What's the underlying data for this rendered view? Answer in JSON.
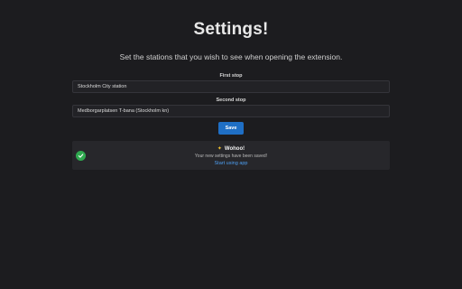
{
  "header": {
    "title": "Settings!",
    "subtitle": "Set the stations that you wish to see when opening the extension."
  },
  "form": {
    "first_stop": {
      "label": "First stop",
      "value": "Stockholm City station"
    },
    "second_stop": {
      "label": "Second stop",
      "value": "Medborgarplatsen T-bana (Stockholm kn)"
    },
    "save_label": "Save"
  },
  "alert": {
    "icon": "check-circle-icon",
    "title_icon": "party-popper-icon",
    "title": "Wohoo!",
    "message": "Your new settings have been saved!",
    "link": "Start using app",
    "colors": {
      "success": "#2fa84f",
      "link": "#4d9ef0"
    }
  },
  "colors": {
    "background": "#1c1c1f",
    "accent": "#1f6fc5"
  }
}
